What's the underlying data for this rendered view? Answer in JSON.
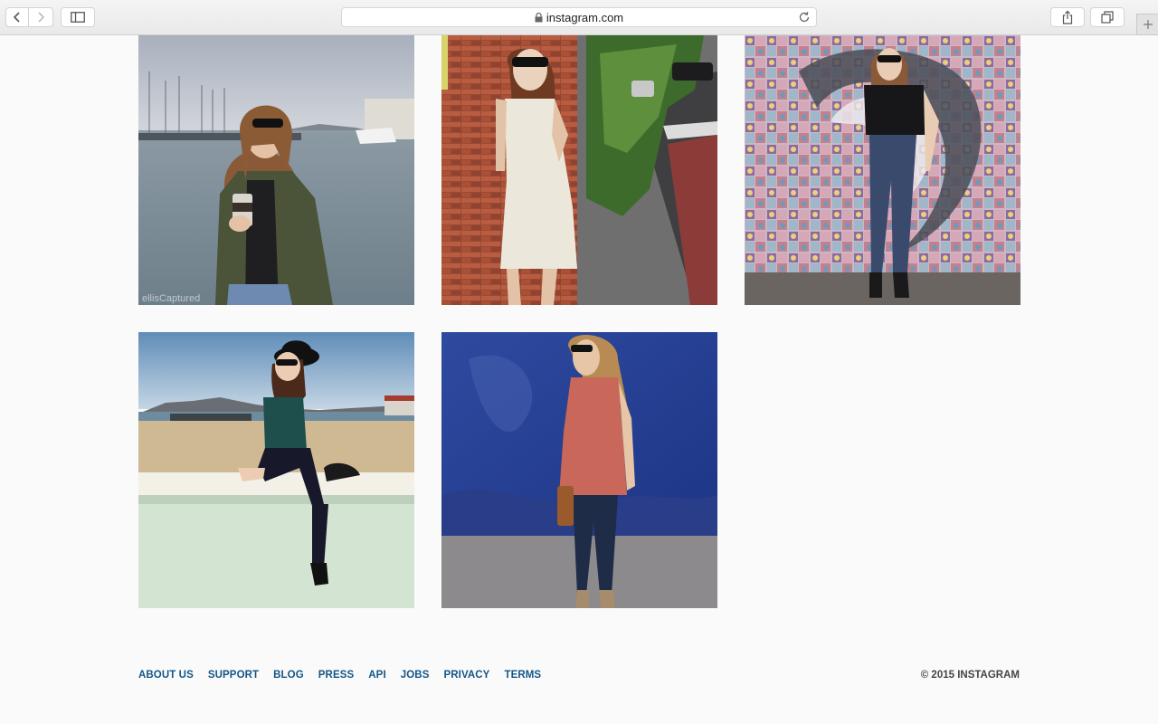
{
  "browser": {
    "url": "instagram.com",
    "icons": {
      "back": "chevron-left-icon",
      "forward": "chevron-right-icon",
      "sidebar": "sidebar-icon",
      "lock": "lock-icon",
      "reload": "reload-icon",
      "share": "share-icon",
      "tabs": "tabs-icon",
      "new_tab": "plus-icon"
    }
  },
  "photos": [
    {
      "scene": "marina-jacket-coffee"
    },
    {
      "scene": "brick-wall-white-dress"
    },
    {
      "scene": "mosaic-wall-black-top"
    },
    {
      "scene": "beach-wall-black-hat"
    },
    {
      "scene": "blue-wall-red-top"
    }
  ],
  "footer": {
    "links": [
      "ABOUT US",
      "SUPPORT",
      "BLOG",
      "PRESS",
      "API",
      "JOBS",
      "PRIVACY",
      "TERMS"
    ],
    "copyright": "© 2015 INSTAGRAM"
  },
  "colors": {
    "link": "#125688",
    "background": "#fafafa"
  }
}
